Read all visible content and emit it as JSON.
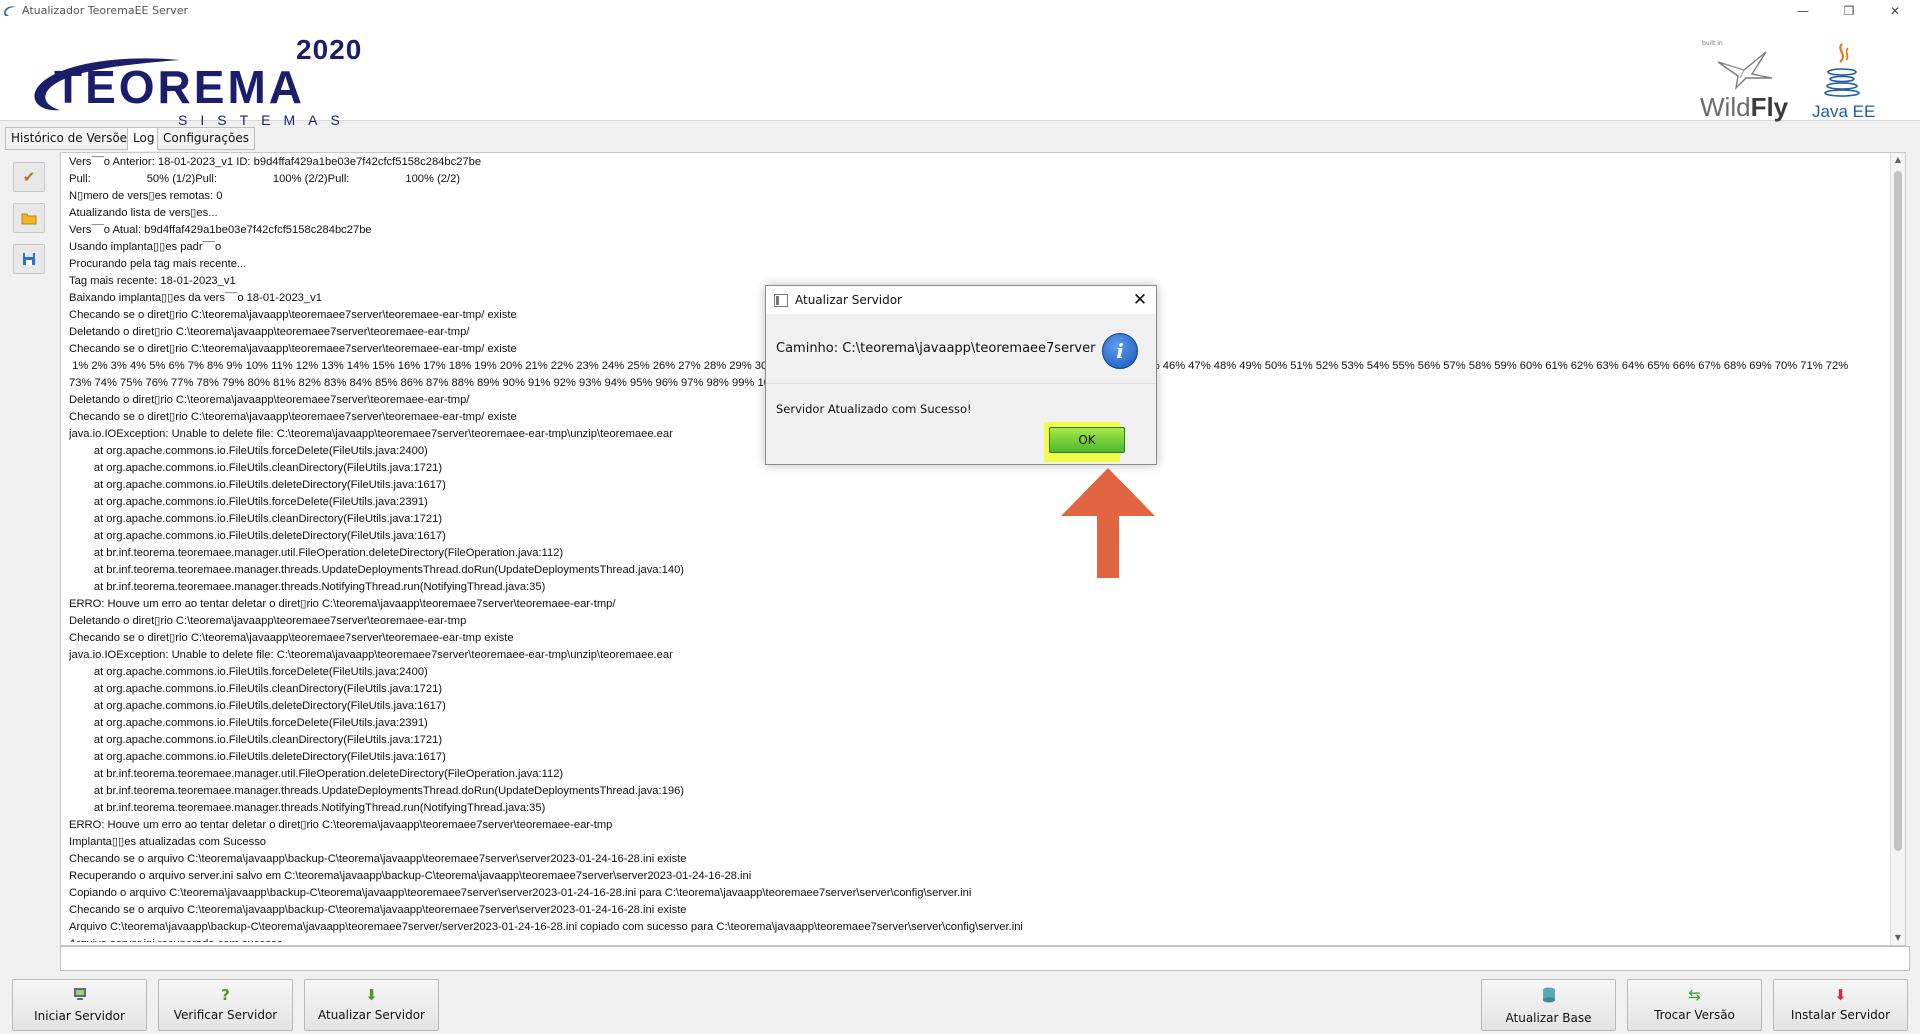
{
  "window": {
    "title": "Atualizador TeoremaEE Server"
  },
  "header": {
    "logo_year": "2020",
    "logo_brand": "TEOREMA",
    "logo_subtitle": "SISTEMAS",
    "wildfly_builtin": "built in",
    "wildfly_text_a": "Wild",
    "wildfly_text_b": "Fly",
    "javaee_text": "Java EE"
  },
  "tabs": [
    {
      "label": "Histórico de Versões",
      "active": false
    },
    {
      "label": "Log",
      "active": true
    },
    {
      "label": "Configurações",
      "active": false
    }
  ],
  "toolbar_icons": [
    "broom-icon",
    "folder-icon",
    "floppy-disk-icon"
  ],
  "log_lines": [
    "Vers¯¯o Anterior: 18-01-2023_v1 ID: b9d4ffaf429a1be03e7f42cfcf5158c284bc27be",
    "Pull:                  50% (1/2)Pull:                  100% (2/2)Pull:                  100% (2/2)",
    "N▯mero de vers▯es remotas: 0",
    "Atualizando lista de vers▯es...",
    "Vers¯¯o Atual: b9d4ffaf429a1be03e7f42cfcf5158c284bc27be",
    "Usando implanta▯▯es padr¯¯o",
    "Procurando pela tag mais recente...",
    "Tag mais recente: 18-01-2023_v1",
    "Baixando implanta▯▯es da vers¯¯o 18-01-2023_v1",
    "Checando se o diret▯rio C:\\teorema\\javaapp\\teoremaee7server\\teoremaee-ear-tmp/ existe",
    "Deletando o diret▯rio C:\\teorema\\javaapp\\teoremaee7server\\teoremaee-ear-tmp/",
    "Checando se o diret▯rio C:\\teorema\\javaapp\\teoremaee7server\\teoremaee-ear-tmp/ existe",
    " 1% 2% 3% 4% 5% 6% 7% 8% 9% 10% 11% 12% 13% 14% 15% 16% 17% 18% 19% 20% 21% 22% 23% 24% 25% 26% 27% 28% 29% 30% 31% 32% 33% 34% 35% 36% 37% 38% 39% 40% 41% 42% 43% 44% 45% 46% 47% 48% 49% 50% 51% 52% 53% 54% 55% 56% 57% 58% 59% 60% 61% 62% 63% 64% 65% 66% 67% 68% 69% 70% 71% 72%",
    "73% 74% 75% 76% 77% 78% 79% 80% 81% 82% 83% 84% 85% 86% 87% 88% 89% 90% 91% 92% 93% 94% 95% 96% 97% 98% 99% 100%",
    "Deletando o diret▯rio C:\\teorema\\javaapp\\teoremaee7server\\teoremaee-ear-tmp/",
    "Checando se o diret▯rio C:\\teorema\\javaapp\\teoremaee7server\\teoremaee-ear-tmp/ existe",
    "java.io.IOException: Unable to delete file: C:\\teorema\\javaapp\\teoremaee7server\\teoremaee-ear-tmp\\unzip\\teoremaee.ear",
    "        at org.apache.commons.io.FileUtils.forceDelete(FileUtils.java:2400)",
    "        at org.apache.commons.io.FileUtils.cleanDirectory(FileUtils.java:1721)",
    "        at org.apache.commons.io.FileUtils.deleteDirectory(FileUtils.java:1617)",
    "        at org.apache.commons.io.FileUtils.forceDelete(FileUtils.java:2391)",
    "        at org.apache.commons.io.FileUtils.cleanDirectory(FileUtils.java:1721)",
    "        at org.apache.commons.io.FileUtils.deleteDirectory(FileUtils.java:1617)",
    "        at br.inf.teorema.teoremaee.manager.util.FileOperation.deleteDirectory(FileOperation.java:112)",
    "        at br.inf.teorema.teoremaee.manager.threads.UpdateDeploymentsThread.doRun(UpdateDeploymentsThread.java:140)",
    "        at br.inf.teorema.teoremaee.manager.threads.NotifyingThread.run(NotifyingThread.java:35)",
    "ERRO: Houve um erro ao tentar deletar o diret▯rio C:\\teorema\\javaapp\\teoremaee7server\\teoremaee-ear-tmp/",
    "Deletando o diret▯rio C:\\teorema\\javaapp\\teoremaee7server\\teoremaee-ear-tmp",
    "Checando se o diret▯rio C:\\teorema\\javaapp\\teoremaee7server\\teoremaee-ear-tmp existe",
    "java.io.IOException: Unable to delete file: C:\\teorema\\javaapp\\teoremaee7server\\teoremaee-ear-tmp\\unzip\\teoremaee.ear",
    "        at org.apache.commons.io.FileUtils.forceDelete(FileUtils.java:2400)",
    "        at org.apache.commons.io.FileUtils.cleanDirectory(FileUtils.java:1721)",
    "        at org.apache.commons.io.FileUtils.deleteDirectory(FileUtils.java:1617)",
    "        at org.apache.commons.io.FileUtils.forceDelete(FileUtils.java:2391)",
    "        at org.apache.commons.io.FileUtils.cleanDirectory(FileUtils.java:1721)",
    "        at org.apache.commons.io.FileUtils.deleteDirectory(FileUtils.java:1617)",
    "        at br.inf.teorema.teoremaee.manager.util.FileOperation.deleteDirectory(FileOperation.java:112)",
    "        at br.inf.teorema.teoremaee.manager.threads.UpdateDeploymentsThread.doRun(UpdateDeploymentsThread.java:196)",
    "        at br.inf.teorema.teoremaee.manager.threads.NotifyingThread.run(NotifyingThread.java:35)",
    "ERRO: Houve um erro ao tentar deletar o diret▯rio C:\\teorema\\javaapp\\teoremaee7server\\teoremaee-ear-tmp",
    "Implanta▯▯es atualizadas com Sucesso",
    "Checando se o arquivo C:\\teorema\\javaapp\\backup-C\\teorema\\javaapp\\teoremaee7server\\server2023-01-24-16-28.ini existe",
    "Recuperando o arquivo server.ini salvo em C:\\teorema\\javaapp\\backup-C\\teorema\\javaapp\\teoremaee7server\\server2023-01-24-16-28.ini",
    "Copiando o arquivo C:\\teorema\\javaapp\\backup-C\\teorema\\javaapp\\teoremaee7server\\server2023-01-24-16-28.ini para C:\\teorema\\javaapp\\teoremaee7server\\server\\config\\server.ini",
    "Checando se o arquivo C:\\teorema\\javaapp\\backup-C\\teorema\\javaapp\\teoremaee7server\\server2023-01-24-16-28.ini existe",
    "Arquivo C:\\teorema\\javaapp\\backup-C\\teorema\\javaapp\\teoremaee7server/server2023-01-24-16-28.ini copiado com sucesso para C:\\teorema\\javaapp\\teoremaee7server\\server\\config\\server.ini",
    "Arquivo server.ini recuperado com sucesso"
  ],
  "command_input": {
    "value": ""
  },
  "bottom_buttons": {
    "iniciar": {
      "label": "Iniciar Servidor",
      "icon": "server-start-icon"
    },
    "verificar": {
      "label": "Verificar Servidor",
      "icon": "question-icon"
    },
    "atualizar": {
      "label": "Atualizar Servidor",
      "icon": "download-icon"
    },
    "atualizar_base": {
      "label": "Atualizar Base",
      "icon": "database-icon"
    },
    "trocar_versao": {
      "label": "Trocar Versão",
      "icon": "swap-icon"
    },
    "instalar": {
      "label": "Instalar Servidor",
      "icon": "install-icon"
    }
  },
  "dialog": {
    "title": "Atualizar Servidor",
    "path": "Caminho: C:\\teorema\\javaapp\\teoremaee7server",
    "message": "Servidor Atualizado com Sucesso!",
    "ok_label": "OK",
    "info_glyph": "i"
  },
  "colors": {
    "brand_navy": "#1b1f6b",
    "ok_green": "#4fb62c",
    "highlight_yellow": "#f2ff2c",
    "arrow_orange": "#e06540",
    "info_blue": "#1a56b8"
  }
}
